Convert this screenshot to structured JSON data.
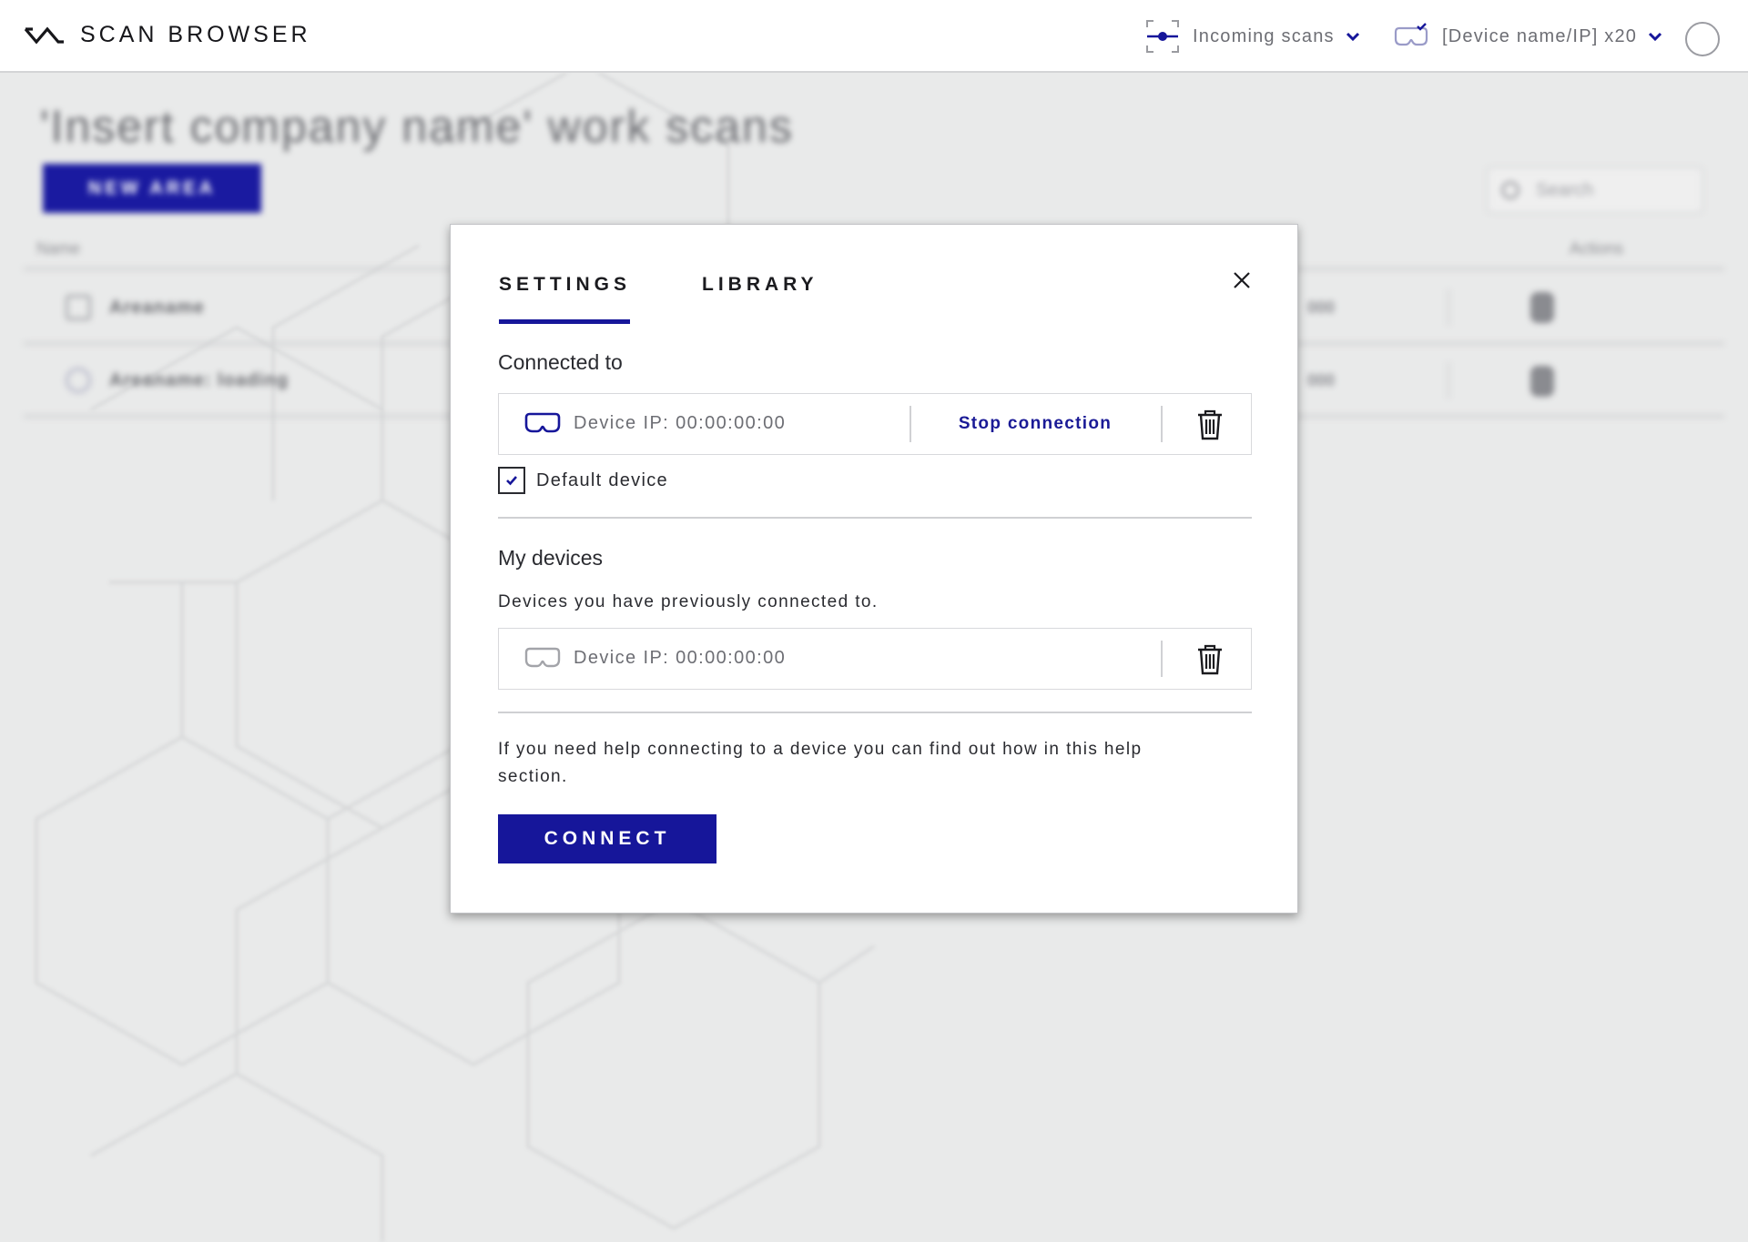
{
  "header": {
    "app_title": "SCAN BROWSER",
    "incoming_scans_label": "Incoming scans",
    "device_menu_label": "[Device name/IP] x20",
    "accent_color": "#16169a"
  },
  "background": {
    "page_title": "'Insert company name' work scans",
    "new_area_label": "NEW AREA",
    "search_placeholder": "Search",
    "column_name": "Name",
    "column_actions": "Actions",
    "rows": [
      {
        "name": "Areaname",
        "value": "000"
      },
      {
        "name": "Areaname: loading",
        "value": "000"
      }
    ]
  },
  "modal": {
    "tabs": [
      {
        "label": "SETTINGS",
        "active": true
      },
      {
        "label": "LIBRARY",
        "active": false
      }
    ],
    "connected_heading": "Connected to",
    "connected_device": {
      "ip_label": "Device IP: 00:00:00:00",
      "stop_label": "Stop connection"
    },
    "default_device": {
      "label": "Default device",
      "checked": true
    },
    "my_devices_heading": "My devices",
    "my_devices_subtitle": "Devices you have previously connected to.",
    "previous_devices": [
      {
        "ip_label": "Device IP: 00:00:00:00"
      }
    ],
    "help_text": "If you need help connecting to a device you can find out how in this help section.",
    "connect_label": "CONNECT"
  },
  "icons": [
    "logo-icon",
    "incoming-scans-icon",
    "chevron-down-icon",
    "vr-headset-icon",
    "close-icon",
    "trash-icon",
    "checkmark-icon"
  ]
}
